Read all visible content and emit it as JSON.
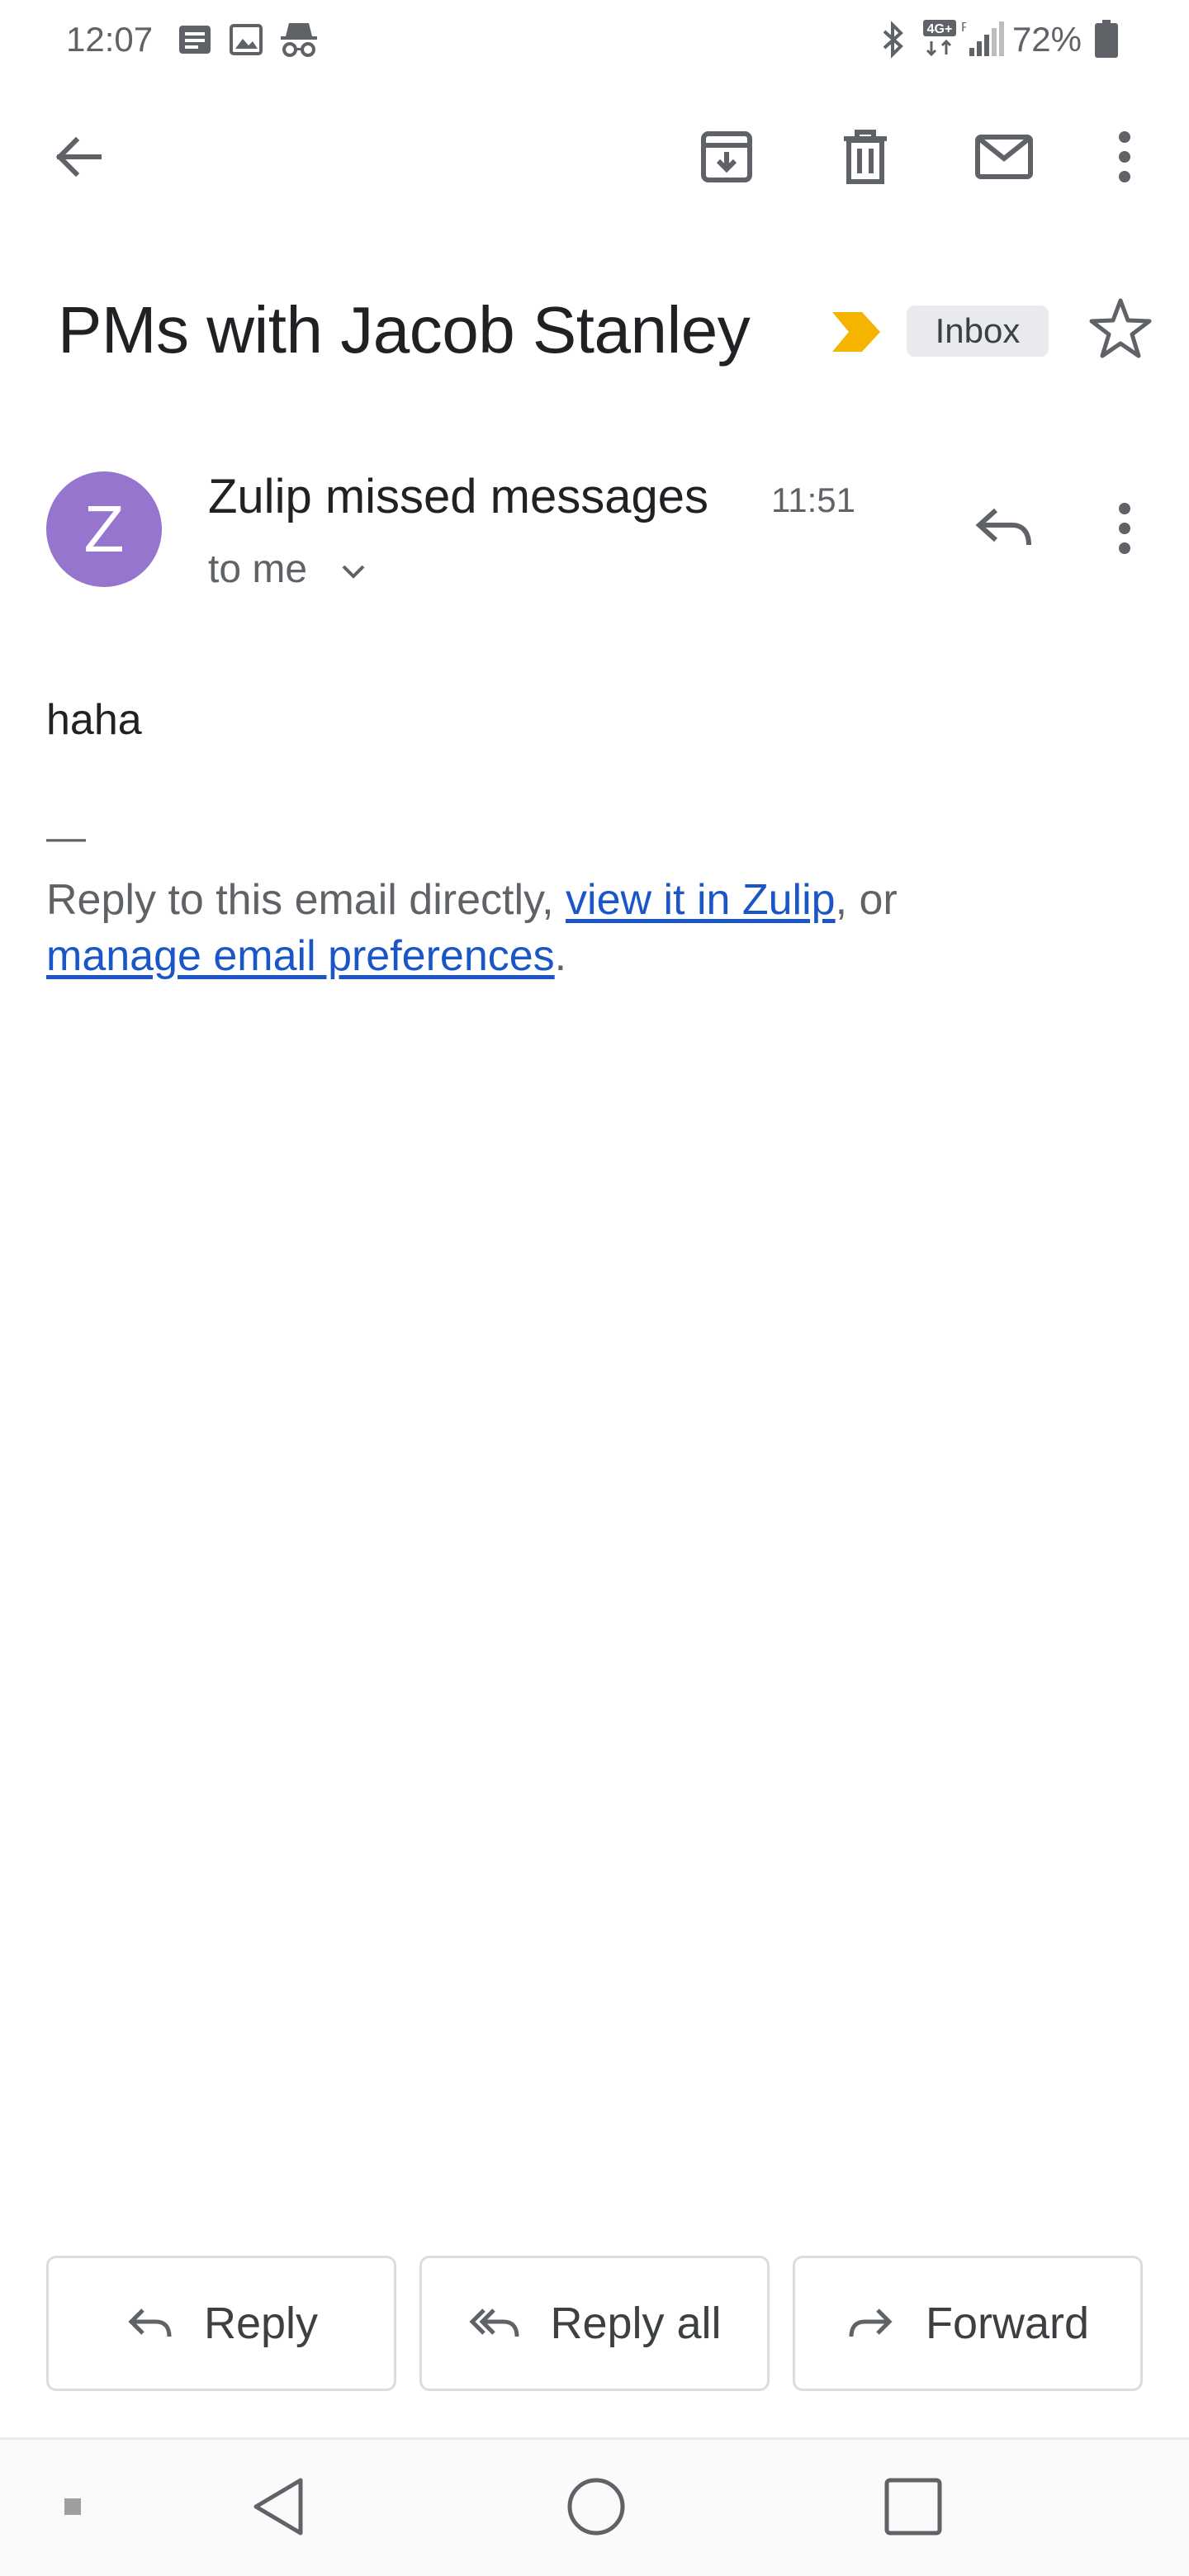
{
  "status_bar": {
    "time": "12:07",
    "battery_percent": "72%",
    "notification_icons": [
      "message-icon",
      "image-icon",
      "incognito-icon"
    ],
    "system_icons": [
      "bluetooth-icon",
      "network-4g-icon",
      "signal-icon",
      "battery-icon"
    ]
  },
  "toolbar": {
    "back_icon": "arrow-left-icon",
    "actions": [
      "archive-icon",
      "delete-icon",
      "mark-unread-icon",
      "more-vert-icon"
    ]
  },
  "email": {
    "subject": "PMs with Jacob Stanley",
    "label": "Inbox",
    "importance_color": "#f4b400",
    "sender": {
      "avatar_letter": "Z",
      "avatar_color": "#9575cd",
      "name": "Zulip missed messages",
      "time": "11:51",
      "recipient": "to me"
    },
    "body": "haha",
    "signature_dash": "—",
    "footer": {
      "prefix": "Reply to this email directly, ",
      "link1": "view it in Zulip",
      "middle": ", or",
      "link2": "manage email preferences",
      "suffix": "."
    }
  },
  "actions": {
    "reply": "Reply",
    "reply_all": "Reply all",
    "forward": "Forward"
  },
  "colors": {
    "link": "#1a56c8",
    "icon_gray": "#5f6368"
  }
}
